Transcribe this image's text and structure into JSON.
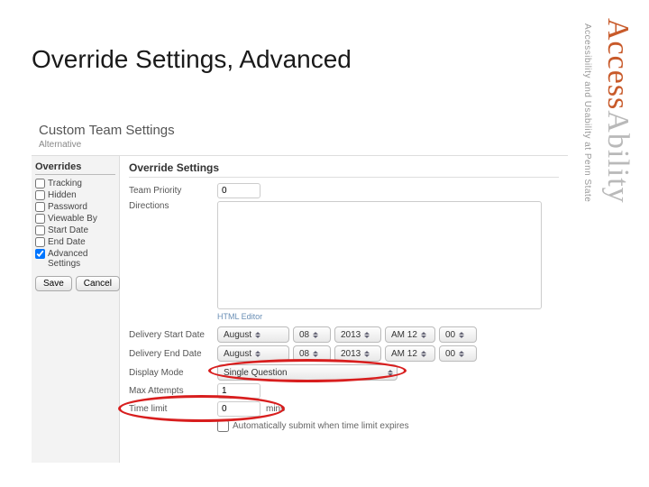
{
  "slide": {
    "title": "Override Settings, Advanced"
  },
  "panel": {
    "title": "Custom Team Settings",
    "subtitle": "Alternative"
  },
  "sidebar": {
    "heading": "Overrides",
    "items": [
      {
        "label": "Tracking",
        "checked": false
      },
      {
        "label": "Hidden",
        "checked": false
      },
      {
        "label": "Password",
        "checked": false
      },
      {
        "label": "Viewable By",
        "checked": false
      },
      {
        "label": "Start Date",
        "checked": false
      },
      {
        "label": "End Date",
        "checked": false
      },
      {
        "label": "Advanced Settings",
        "checked": true
      }
    ],
    "save": "Save",
    "cancel": "Cancel"
  },
  "main": {
    "heading": "Override Settings",
    "team_priority_label": "Team Priority",
    "team_priority_value": "0",
    "directions_label": "Directions",
    "html_editor_link": "HTML Editor",
    "delivery_start_label": "Delivery Start Date",
    "delivery_end_label": "Delivery End Date",
    "display_mode_label": "Display Mode",
    "display_mode_value": "Single Question",
    "max_attempts_label": "Max Attempts",
    "max_attempts_value": "1",
    "time_limit_label": "Time limit",
    "time_limit_value": "0",
    "time_limit_unit": "mins",
    "auto_submit_label": "Automatically submit when time limit expires",
    "start_date": {
      "month": "August",
      "day": "08",
      "year": "2013",
      "ampm": "AM 12",
      "minute": "00"
    },
    "end_date": {
      "month": "August",
      "day": "08",
      "year": "2013",
      "ampm": "AM 12",
      "minute": "00"
    }
  },
  "watermark": {
    "brand_1": "Access",
    "brand_2": "Ability",
    "tagline": "Accessibility and Usability at Penn State"
  }
}
